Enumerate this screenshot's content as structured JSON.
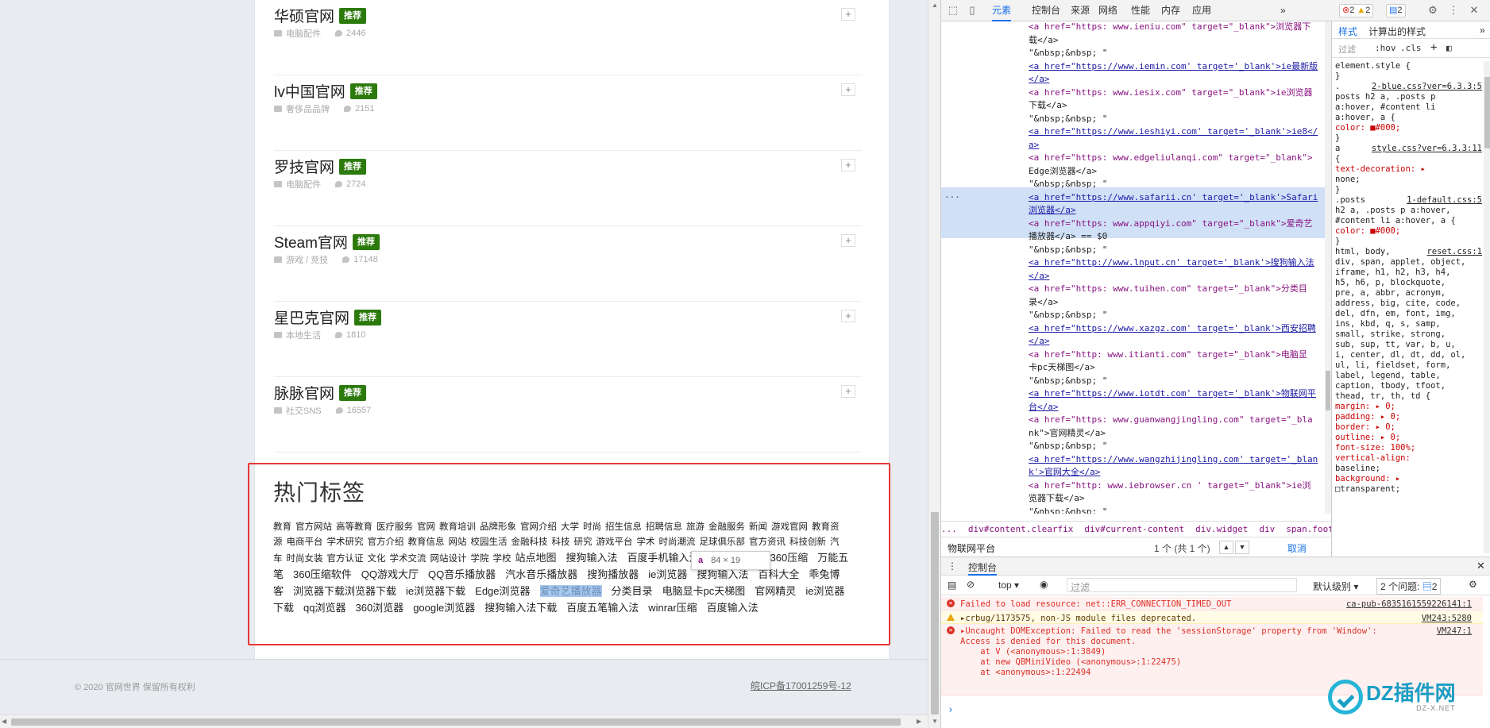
{
  "sites": [
    {
      "name": "华硕官网",
      "badge": "推荐",
      "category": "电脑配件",
      "count": "2446"
    },
    {
      "name": "lv中国官网",
      "badge": "推荐",
      "category": "奢侈品品牌",
      "count": "2151"
    },
    {
      "name": "罗技官网",
      "badge": "推荐",
      "category": "电脑配件",
      "count": "2724"
    },
    {
      "name": "Steam官网",
      "badge": "推荐",
      "category": "游戏 / 竞技",
      "count": "17148"
    },
    {
      "name": "星巴克官网",
      "badge": "推荐",
      "category": "本地生活",
      "count": "1810"
    },
    {
      "name": "脉脉官网",
      "badge": "推荐",
      "category": "社交SNS",
      "count": "16557"
    }
  ],
  "hot_tags": {
    "title": "热门标签",
    "small_tags": [
      "教育",
      "官方网站",
      "高等教育",
      "医疗服务",
      "官网",
      "教育培训",
      "品牌形象",
      "官网介绍",
      "大学",
      "时尚",
      "招生信息",
      "招聘信息",
      "旅游",
      "金融服务",
      "新闻",
      "游戏官网",
      "教育资源",
      "电商平台",
      "学术研究",
      "官方介绍",
      "教育信息",
      "网站",
      "校园生活",
      "金融科技",
      "科技",
      "研究",
      "游戏平台",
      "学术",
      "时尚潮流",
      "足球俱乐部",
      "官方资讯",
      "科技创新",
      "汽车",
      "时尚女装",
      "官方认证",
      "文化",
      "学术交流",
      "网站设计",
      "学院",
      "学校"
    ],
    "big_tags": [
      "站点地图",
      "搜狗输入法",
      "百度手机输入法",
      "搜狗输入法",
      "360压缩",
      "万能五笔",
      "360压缩软件",
      "QQ游戏大厅",
      "QQ音乐播放器",
      "汽水音乐播放器",
      "搜狗播放器",
      "ie浏览器",
      "搜狗输入法",
      "百科大全",
      "乖兔博客",
      "浏览器下载浏览器下载",
      "ie浏览器下载",
      "Edge浏览器",
      "爱奇艺播放器",
      "分类目录",
      "电脑显卡pc天梯图",
      "官网精灵",
      "ie浏览器下载",
      "qq浏览器",
      "360浏览器",
      "google浏览器",
      "搜狗输入法下载",
      "百度五笔输入法",
      "winrar压缩",
      "百度输入法"
    ],
    "highlight": "爱奇艺播放器"
  },
  "tooltip": {
    "tag": "a",
    "size": "84 × 19"
  },
  "footer": {
    "copyright": "© 2020 官网世界 保留所有权利",
    "icp": "皖ICP备17001259号-12"
  },
  "devtools": {
    "tabs": [
      "元素",
      "控制台",
      "来源",
      "网络",
      "性能",
      "内存",
      "应用"
    ],
    "more": "»",
    "error_count": "2",
    "warn_count": "2",
    "msg_count": "2",
    "elements_lines": [
      {
        "kind": "code",
        "text": "<a href=\"https: www.ieniu.com\" target=\"_blank\">浏览器下"
      },
      {
        "kind": "text",
        "text": "载</a>"
      },
      {
        "kind": "text",
        "text": "\"&nbsp;&nbsp; \""
      },
      {
        "kind": "link",
        "text": "<a href=\"https://www.iemin.com' target='_blank'>ie最新版"
      },
      {
        "kind": "link",
        "text": "</a>"
      },
      {
        "kind": "code",
        "text": "<a href=\"https: www.iesix.com\" target=\"_blank\">ie浏览器"
      },
      {
        "kind": "text",
        "text": "下载</a>"
      },
      {
        "kind": "text",
        "text": "\"&nbsp;&nbsp; \""
      },
      {
        "kind": "link",
        "text": "<a href=\"https://www.ieshiyi.com' target='_blank'>ie8</"
      },
      {
        "kind": "link",
        "text": "a>"
      },
      {
        "kind": "code",
        "text": "<a href=\"https: www.edgeliulanqi.com\" target=\"_blank\">"
      },
      {
        "kind": "text",
        "text": "Edge浏览器</a>"
      },
      {
        "kind": "text",
        "text": "\"&nbsp;&nbsp; \""
      },
      {
        "kind": "link",
        "text": "<a href=\"https://www.safarii.cn' target='_blank'>Safari"
      },
      {
        "kind": "link",
        "text": "浏览器</a>"
      },
      {
        "kind": "code",
        "text": "<a href=\"https: www.appqiyi.com\" target=\"_blank\">爱奇艺"
      },
      {
        "kind": "text",
        "text": "播放器</a> == $0"
      },
      {
        "kind": "text",
        "text": "\"&nbsp;&nbsp; \""
      },
      {
        "kind": "link",
        "text": "<a href=\"http://www.lnput.cn' target='_blank'>搜狗输入法"
      },
      {
        "kind": "link",
        "text": "</a>"
      },
      {
        "kind": "code",
        "text": "<a href=\"https: www.tuihen.com\" target=\"_blank\">分类目"
      },
      {
        "kind": "text",
        "text": "录</a>"
      },
      {
        "kind": "text",
        "text": "\"&nbsp;&nbsp; \""
      },
      {
        "kind": "link",
        "text": "<a href=\"https://www.xazgz.com' target='_blank'>西安招聘"
      },
      {
        "kind": "link",
        "text": "</a>"
      },
      {
        "kind": "code",
        "text": "<a href=\"http: www.itianti.com\" target=\"_blank\">电脑显"
      },
      {
        "kind": "text",
        "text": "卡pc天梯图</a>"
      },
      {
        "kind": "text",
        "text": "\"&nbsp;&nbsp; \""
      },
      {
        "kind": "link",
        "text": "<a href=\"https://www.iotdt.com' target='_blank'>物联网平"
      },
      {
        "kind": "link",
        "text": "台</a>"
      },
      {
        "kind": "code",
        "text": "<a href=\"https: www.guanwangjingling.com\" target=\"_bla"
      },
      {
        "kind": "text",
        "text": "nk\">官网精灵</a>"
      },
      {
        "kind": "text",
        "text": "\"&nbsp;&nbsp; \""
      },
      {
        "kind": "link",
        "text": "<a href=\"https://www.wangzhijingling.com' target='_blan"
      },
      {
        "kind": "link",
        "text": "k'>官网大全</a>"
      },
      {
        "kind": "code",
        "text": "<a href=\"http: www.iebrowser.cn ' target=\"_blank\">ie浏"
      },
      {
        "kind": "text",
        "text": "览器下载</a>"
      },
      {
        "kind": "text",
        "text": "\"&nbsp;&nbsp; \""
      }
    ],
    "dots": "...",
    "breadcrumb": [
      "...",
      "div#content.clearfix",
      "div#current-content",
      "div.widget",
      "div",
      "span.footera",
      "a"
    ],
    "find": {
      "query": "物联网平台",
      "count": "1 个 (共 1 个)",
      "cancel": "取消"
    },
    "styles_tabs": [
      "样式",
      "计算出的样式",
      "»"
    ],
    "styles_filter": "过滤",
    "styles_hov": ":hov",
    "styles_cls": ".cls",
    "styles_plus": "+",
    "style_rules": [
      {
        "sel": "element.style {",
        "src": ""
      },
      {
        "sel": "}",
        "src": ""
      },
      {
        "sel": ".",
        "src": "2-blue.css?ver=6.3.3:5"
      },
      {
        "sel": "posts h2 a, .posts p",
        "src": ""
      },
      {
        "sel": "a:hover, #content li",
        "src": ""
      },
      {
        "sel": "a:hover, a {",
        "src": ""
      },
      {
        "sel": "  color: ■#000;",
        "src": "",
        "prop": true
      },
      {
        "sel": "}",
        "src": ""
      },
      {
        "sel": "a",
        "src": "style.css?ver=6.3.3:11"
      },
      {
        "sel": "{",
        "src": ""
      },
      {
        "sel": "  text-decoration: ▸",
        "src": "",
        "prop": true
      },
      {
        "sel": "      none;",
        "src": ""
      },
      {
        "sel": "}",
        "src": ""
      },
      {
        "sel": ".posts",
        "src": "1-default.css:5"
      },
      {
        "sel": "h2 a, .posts p a:hover,",
        "src": ""
      },
      {
        "sel": "#content li a:hover, a {",
        "src": ""
      },
      {
        "sel": "  color: ■#000;",
        "src": "",
        "prop": true
      },
      {
        "sel": "}",
        "src": ""
      },
      {
        "sel": "html, body,",
        "src": "reset.css:1"
      },
      {
        "sel": "div, span, applet, object,",
        "src": ""
      },
      {
        "sel": "iframe, h1, h2, h3, h4,",
        "src": ""
      },
      {
        "sel": "h5, h6, p, blockquote,",
        "src": ""
      },
      {
        "sel": "pre, a, abbr, acronym,",
        "src": ""
      },
      {
        "sel": "address, big, cite, code,",
        "src": ""
      },
      {
        "sel": "del, dfn, em, font, img,",
        "src": ""
      },
      {
        "sel": "ins, kbd, q, s, samp,",
        "src": ""
      },
      {
        "sel": "small, strike, strong,",
        "src": ""
      },
      {
        "sel": "sub, sup, tt, var, b, u,",
        "src": ""
      },
      {
        "sel": "i, center, dl, dt, dd, ol,",
        "src": ""
      },
      {
        "sel": "ul, li, fieldset, form,",
        "src": ""
      },
      {
        "sel": "label, legend, table,",
        "src": ""
      },
      {
        "sel": "caption, tbody, tfoot,",
        "src": ""
      },
      {
        "sel": "thead, tr, th, td {",
        "src": ""
      },
      {
        "sel": "  margin: ▸ 0;",
        "src": "",
        "prop": true
      },
      {
        "sel": "  padding: ▸ 0;",
        "src": "",
        "prop": true
      },
      {
        "sel": "  border: ▸ 0;",
        "src": "",
        "prop": true
      },
      {
        "sel": "  outline: ▸ 0;",
        "src": "",
        "prop": true
      },
      {
        "sel": "  font-size: 100%;",
        "src": "",
        "prop": true
      },
      {
        "sel": "  vertical-align:",
        "src": "",
        "prop": true
      },
      {
        "sel": "      baseline;",
        "src": ""
      },
      {
        "sel": "  background: ▸",
        "src": "",
        "prop": true
      },
      {
        "sel": "     □transparent;",
        "src": ""
      }
    ],
    "console": {
      "title": "控制台",
      "context": "top ▾",
      "filter_placeholder": "过滤",
      "level": "默认级别 ▾",
      "issues": "2 个问题:",
      "issues_count": "2",
      "messages": [
        {
          "type": "error",
          "text": "Failed to load resource: net::ERR_CONNECTION_TIMED_OUT",
          "src": "ca-pub-6835161559226141:1"
        },
        {
          "type": "warn",
          "text": "▸crbug/1173575, non-JS module files deprecated.",
          "src": "VM243:5280"
        },
        {
          "type": "error",
          "text": "▸Uncaught DOMException: Failed to read the 'sessionStorage' property from 'Window':\nAccess is denied for this document.\n    at V (<anonymous>:1:3849)\n    at new QBMiniVideo (<anonymous>:1:22475)\n    at <anonymous>:1:22494",
          "src": "VM247:1"
        }
      ],
      "prompt": "›"
    }
  },
  "watermark": {
    "text": "DZ插件网",
    "sub": "DZ-X.NET"
  }
}
